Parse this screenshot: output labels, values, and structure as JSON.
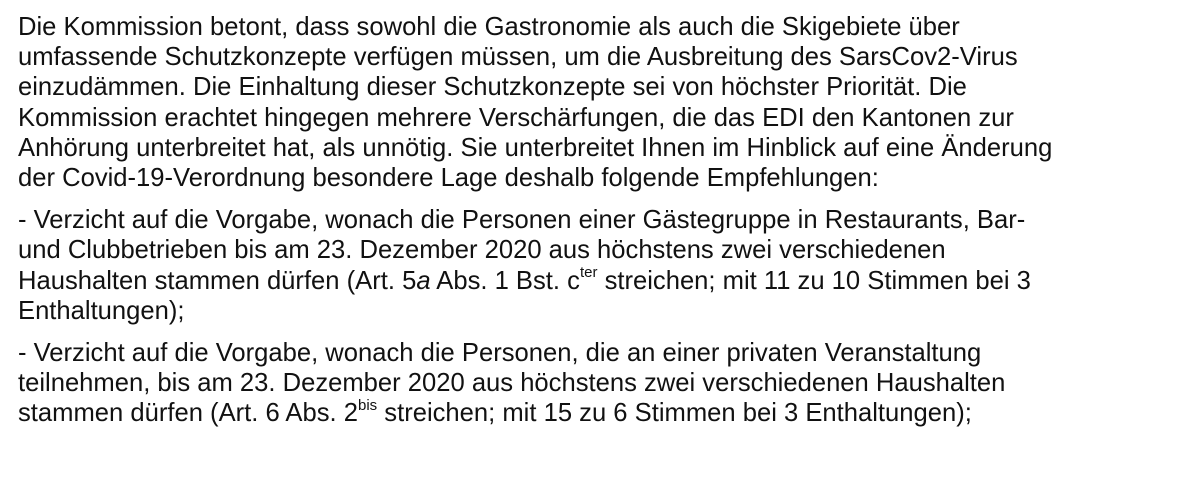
{
  "paragraphs": [
    {
      "lines": [
        "Die Kommission betont, dass sowohl die Gastronomie als auch die Skigebiete über",
        "umfassende Schutzkonzepte verfügen müssen, um die Ausbreitung des SarsCov2-Virus",
        "einzudämmen. Die Einhaltung dieser Schutzkonzepte sei von höchster Priorität. Die",
        "Kommission erachtet hingegen mehrere Verschärfungen, die das EDI den Kantonen zur",
        "Anhörung unterbreitet hat, als unnötig. Sie unterbreitet Ihnen im Hinblick auf eine Änderung",
        "der Covid-19-Verordnung besondere Lage deshalb folgende Empfehlungen:"
      ]
    },
    {
      "lines": [
        "- Verzicht auf die Vorgabe, wonach die Personen einer Gästegruppe in Restaurants, Bar-",
        "und Clubbetrieben bis am 23. Dezember 2020 aus höchstens zwei verschiedenen",
        "Haushalten stammen dürfen (Art. 5",
        "Enthaltungen);"
      ],
      "line3_italic": "a",
      "line3_mid": " Abs. 1 Bst. c",
      "line3_sup": "ter",
      "line3_end": " streichen; mit 11 zu 10 Stimmen bei 3"
    },
    {
      "lines": [
        "- Verzicht auf die Vorgabe, wonach die Personen, die an einer privaten Veranstaltung",
        "teilnehmen, bis am 23. Dezember 2020 aus höchstens zwei verschiedenen Haushalten",
        "stammen dürfen (Art. 6 Abs. 2"
      ],
      "line3_sup": "bis",
      "line3_end": " streichen; mit 15 zu 6 Stimmen bei 3 Enthaltungen);"
    }
  ]
}
